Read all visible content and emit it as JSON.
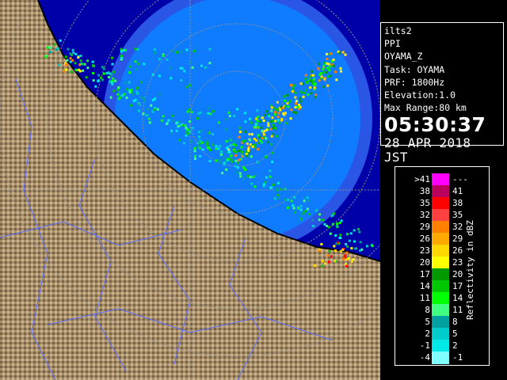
{
  "info": {
    "product": "ilts2",
    "mode": "PPI",
    "radar_id": "OYAMA_Z",
    "task": "Task: OYAMA",
    "prf": "PRF: 1800Hz",
    "elevation": "Elevation:1.0",
    "max_range": "Max Range:80 km",
    "time": "05:30:37",
    "date": "28 APR 2018 JST"
  },
  "legend": {
    "title": "Reflectivity in dBZ",
    "rows": [
      {
        "low": ">41",
        "high": "---",
        "color": "#ff00ff"
      },
      {
        "low": "38",
        "high": "41",
        "color": "#b8005c"
      },
      {
        "low": "35",
        "high": "38",
        "color": "#ff0000"
      },
      {
        "low": "32",
        "high": "35",
        "color": "#ff4040"
      },
      {
        "low": "29",
        "high": "32",
        "color": "#ff8000"
      },
      {
        "low": "26",
        "high": "29",
        "color": "#ffaa00"
      },
      {
        "low": "23",
        "high": "26",
        "color": "#ffd800"
      },
      {
        "low": "20",
        "high": "23",
        "color": "#ffff00"
      },
      {
        "low": "17",
        "high": "20",
        "color": "#009900"
      },
      {
        "low": "14",
        "high": "17",
        "color": "#00c800"
      },
      {
        "low": "11",
        "high": "14",
        "color": "#00ff00"
      },
      {
        "low": "8",
        "high": "11",
        "color": "#40ff80"
      },
      {
        "low": "5",
        "high": "8",
        "color": "#00a0a0"
      },
      {
        "low": "2",
        "high": "5",
        "color": "#00cccc"
      },
      {
        "low": "-1",
        "high": "2",
        "color": "#00e8e8"
      },
      {
        "low": "-4",
        "high": "-1",
        "color": "#80ffff"
      }
    ]
  },
  "map": {
    "sea_color": "#1e63ff",
    "land_color": "#a88f6a",
    "outside_color": "#0000a8",
    "range_ring_color": "#808080"
  }
}
